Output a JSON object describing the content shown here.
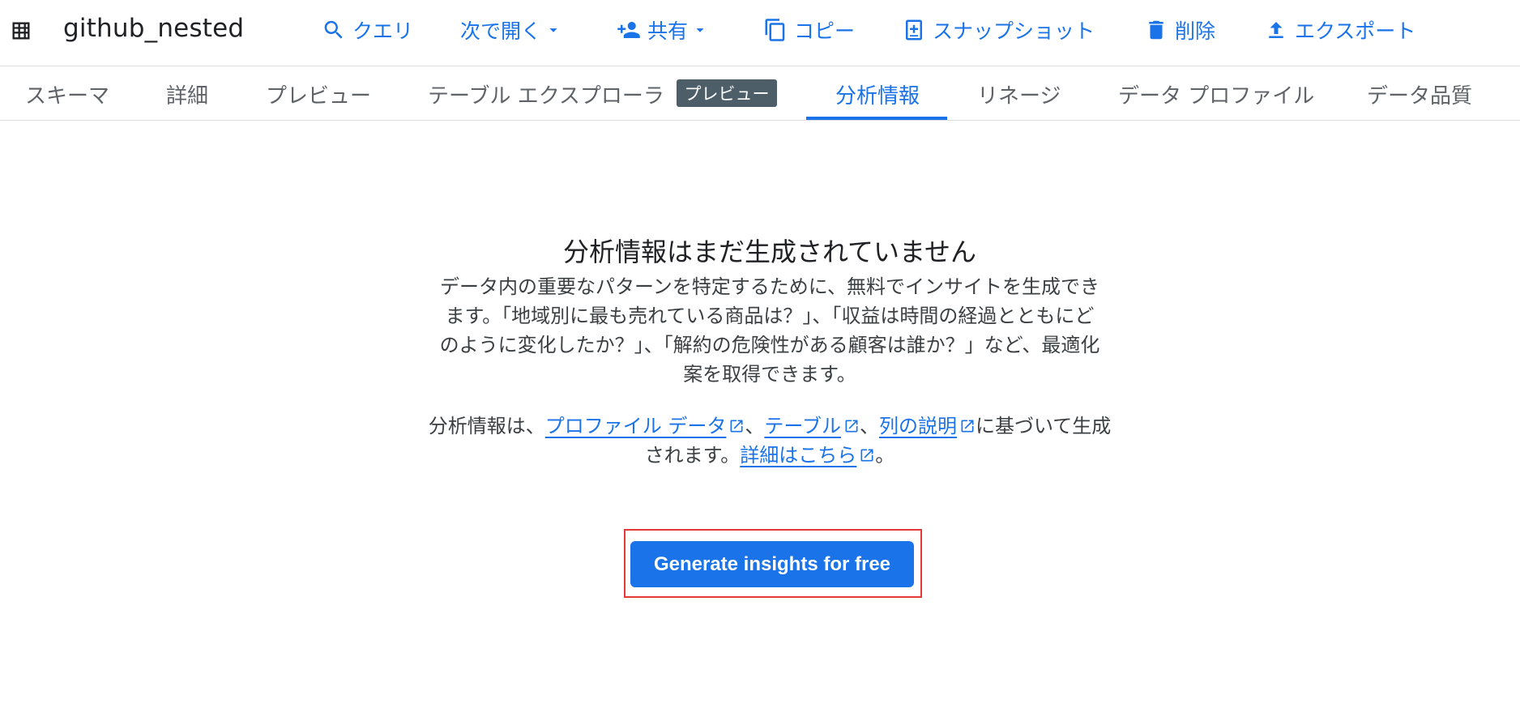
{
  "header": {
    "table_title": "github_nested",
    "actions": {
      "query": "クエリ",
      "open_in": "次で開く",
      "share": "共有",
      "copy": "コピー",
      "snapshot": "スナップショット",
      "delete": "削除",
      "export": "エクスポート"
    }
  },
  "tabs": {
    "schema": "スキーマ",
    "details": "詳細",
    "preview": "プレビュー",
    "table_explorer": "テーブル エクスプローラ",
    "table_explorer_badge": "プレビュー",
    "insights": "分析情報",
    "lineage": "リネージ",
    "data_profile": "データ プロファイル",
    "data_quality": "データ品質",
    "active": "insights"
  },
  "empty_state": {
    "title": "分析情報はまだ生成されていません",
    "description": "データ内の重要なパターンを特定するために、無料でインサイトを生成できます。「地域別に最も売れている商品は？」、「収益は時間の経過とともにどのように変化したか？」、「解約の危険性がある顧客は誰か？」など、最適化案を取得できます。",
    "basis_prefix": "分析情報は、",
    "link_profile_data": "プロファイル データ",
    "separator": "、",
    "link_table": "テーブル",
    "link_column_descriptions": "列の説明",
    "basis_suffix": "に基づいて生成されます。",
    "link_learn_more": "詳細はこちら",
    "period": "。"
  },
  "cta": {
    "label": "Generate insights for free"
  },
  "colors": {
    "accent": "#1a73e8",
    "badge_bg": "#4d5e69",
    "highlight": "#e53935"
  }
}
